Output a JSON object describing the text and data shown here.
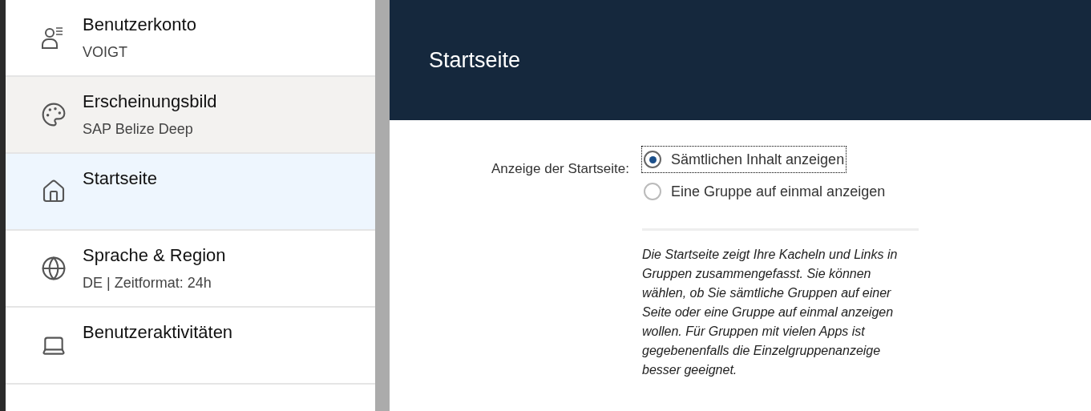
{
  "sidebar": {
    "items": [
      {
        "kind": "user",
        "title": "Benutzerkonto",
        "subtitle": "VOIGT",
        "selected": false,
        "hovered": false
      },
      {
        "kind": "palette",
        "title": "Erscheinungsbild",
        "subtitle": "SAP Belize Deep",
        "selected": false,
        "hovered": true
      },
      {
        "kind": "home",
        "title": "Startseite",
        "selected": true,
        "hovered": false
      },
      {
        "kind": "globe",
        "title": "Sprache & Region",
        "subtitle": "DE | Zeitformat: 24h",
        "selected": false,
        "hovered": false
      },
      {
        "kind": "laptop",
        "title": "Benutzeraktivitäten",
        "selected": false,
        "hovered": false
      }
    ]
  },
  "page": {
    "title": "Startseite",
    "field_label": "Anzeige der Startseite:",
    "options": [
      {
        "label": "Sämtlichen Inhalt anzeigen",
        "selected": true,
        "focused": true
      },
      {
        "label": "Eine Gruppe auf einmal anzeigen",
        "selected": false,
        "focused": false
      }
    ],
    "description": "Die Startseite zeigt Ihre Kacheln und Links in Gruppen zusammengefasst. Sie können wählen, ob Sie sämtliche Gruppen auf einer Seite oder eine Gruppe auf einmal anzeigen wollen. Für Gruppen mit vielen Apps ist gegebenenfalls die Einzelgruppenanzeige besser geeignet."
  }
}
